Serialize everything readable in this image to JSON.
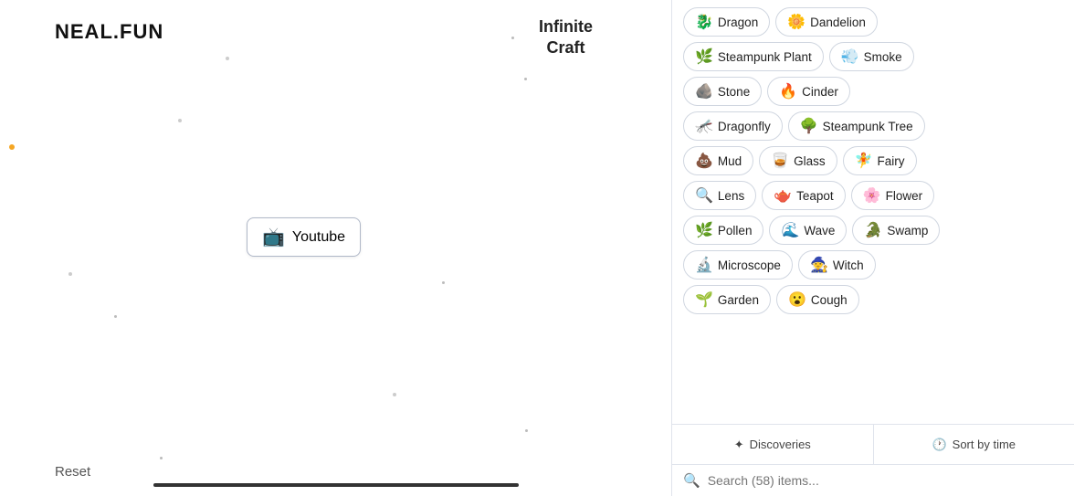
{
  "logo": {
    "text": "NEAL.FUN",
    "separator": "•"
  },
  "craft_title": {
    "line1": "Infinite",
    "line2": "Craft"
  },
  "youtube_element": {
    "emoji": "📺",
    "label": "Youtube"
  },
  "reset_button": {
    "label": "Reset"
  },
  "items": [
    [
      {
        "emoji": "🐉",
        "label": "Dragon"
      },
      {
        "emoji": "🌼",
        "label": "Dandelion"
      }
    ],
    [
      {
        "emoji": "🌿",
        "label": "Steampunk Plant"
      },
      {
        "emoji": "💨",
        "label": "Smoke"
      }
    ],
    [
      {
        "emoji": "🪨",
        "label": "Stone"
      },
      {
        "emoji": "🔥",
        "label": "Cinder"
      }
    ],
    [
      {
        "emoji": "🦟",
        "label": "Dragonfly"
      },
      {
        "emoji": "🌳",
        "label": "Steampunk Tree"
      }
    ],
    [
      {
        "emoji": "💩",
        "label": "Mud"
      },
      {
        "emoji": "🥃",
        "label": "Glass"
      },
      {
        "emoji": "🧚",
        "label": "Fairy"
      }
    ],
    [
      {
        "emoji": "🔍",
        "label": "Lens"
      },
      {
        "emoji": "🫖",
        "label": "Teapot"
      },
      {
        "emoji": "🌸",
        "label": "Flower"
      }
    ],
    [
      {
        "emoji": "🌿",
        "label": "Pollen"
      },
      {
        "emoji": "🌊",
        "label": "Wave"
      },
      {
        "emoji": "🐊",
        "label": "Swamp"
      }
    ],
    [
      {
        "emoji": "🔬",
        "label": "Microscope"
      },
      {
        "emoji": "🧙",
        "label": "Witch"
      }
    ],
    [
      {
        "emoji": "🌱",
        "label": "Garden"
      },
      {
        "emoji": "😮",
        "label": "Cough"
      }
    ]
  ],
  "tabs": {
    "discoveries_icon": "✦",
    "discoveries_label": "Discoveries",
    "sort_icon": "🕐",
    "sort_label": "Sort by time"
  },
  "search": {
    "icon": "🔍",
    "placeholder": "Search (58) items..."
  }
}
